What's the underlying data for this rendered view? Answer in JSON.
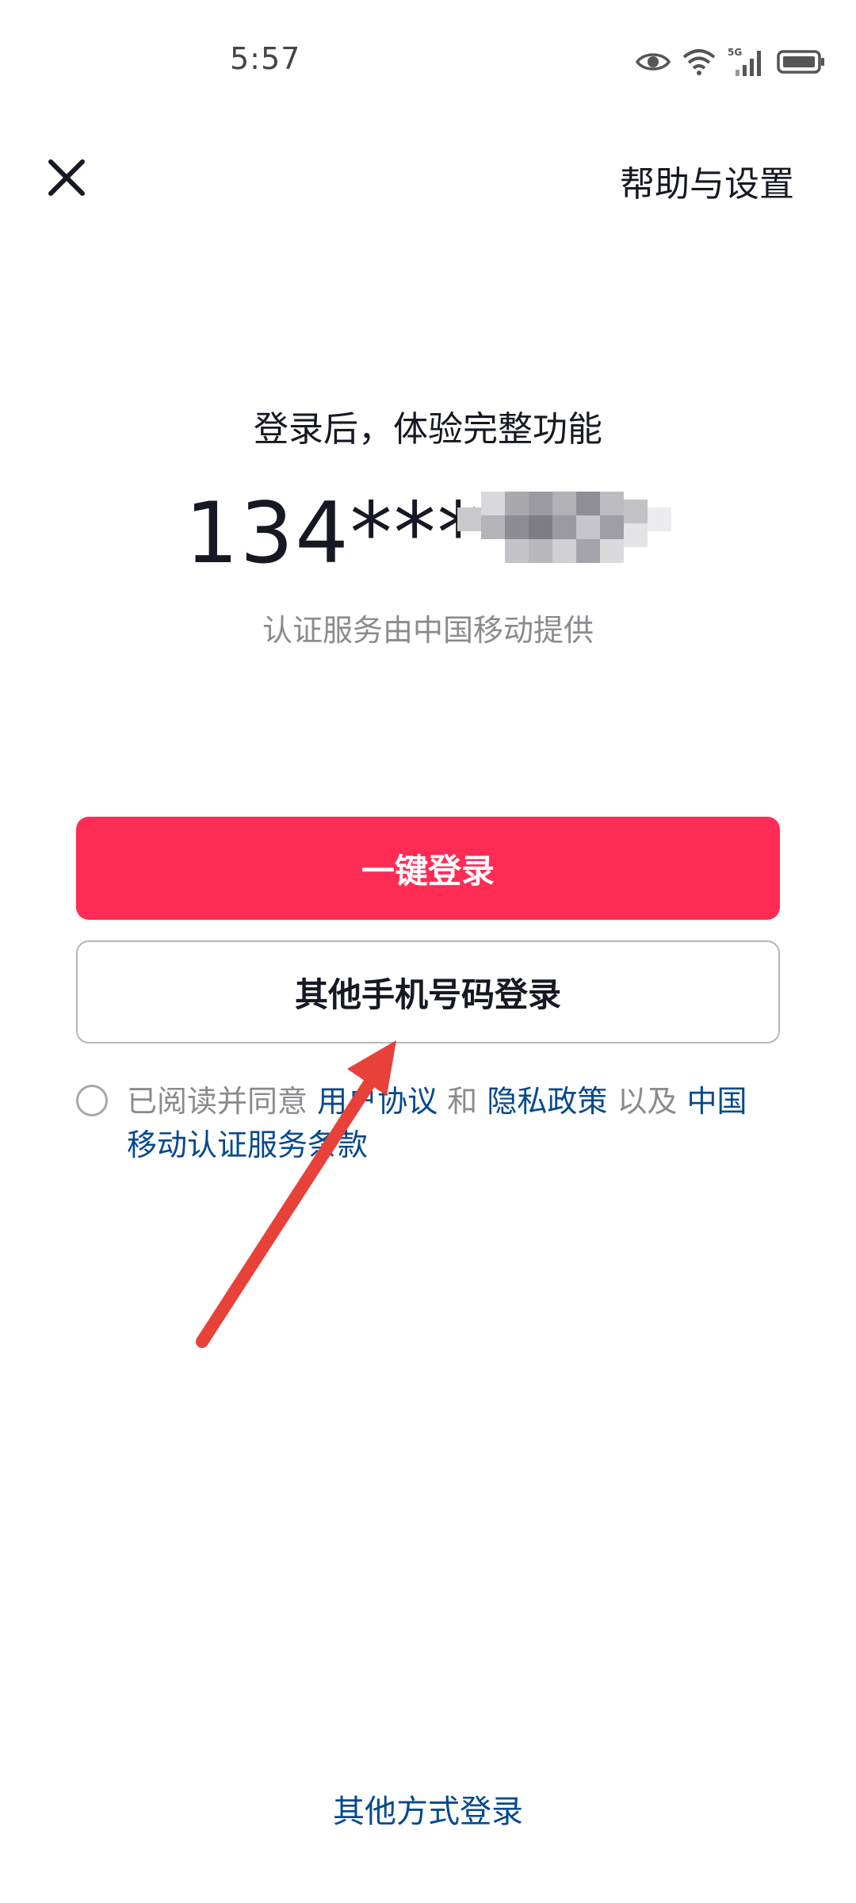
{
  "status_bar": {
    "time": "5:57",
    "network_label": "5G",
    "icons": [
      "eye-icon",
      "wifi-icon",
      "signal-5g-icon",
      "battery-icon"
    ]
  },
  "header": {
    "close_icon": "close-icon",
    "help_label": "帮助与设置"
  },
  "main": {
    "subtitle": "登录后，体验完整功能",
    "phone_visible": "134***",
    "provider_note": "认证服务由中国移动提供"
  },
  "buttons": {
    "one_click_login": "一键登录",
    "other_phone_login": "其他手机号码登录"
  },
  "agreement": {
    "prefix": "已阅读并同意",
    "user_agreement": "用户协议",
    "and": "和",
    "privacy_policy": "隐私政策",
    "as_well_as": "以及",
    "cmcc_terms": "中国移动认证服务条款",
    "checked": false
  },
  "footer": {
    "other_methods": "其他方式登录"
  },
  "colors": {
    "primary": "#fe2c55",
    "link": "#04498d",
    "annotation_arrow": "#e8413a"
  }
}
